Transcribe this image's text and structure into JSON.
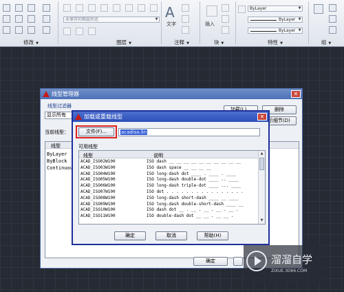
{
  "ribbon": {
    "groups": [
      {
        "name": "修改"
      },
      {
        "name": "图层"
      },
      {
        "name": "注释"
      },
      {
        "name": "块"
      },
      {
        "name": "特性"
      },
      {
        "name": "组"
      }
    ],
    "layer_state": "未保存的图层状态",
    "text_label": "文字",
    "insert_label": "插入",
    "bylayer_1": "ByLayer",
    "bylayer_2": "ByLayer",
    "bylayer_3": "ByLayer"
  },
  "linetype_manager": {
    "title": "线型管理器",
    "filter_group_label": "线型过滤器",
    "filter_value": "显示所有",
    "current_label": "当前线型：",
    "load_button": "加载(L)...",
    "delete_button": "删除",
    "details_button": "示细节(D)",
    "list_header": "线型",
    "items": [
      "ByLayer",
      "ByBlock",
      "Continuous"
    ],
    "ok_button": "确定"
  },
  "load_dialog": {
    "title": "加载或重载线型",
    "file_button": "文件(F)...",
    "file_name": "acadiso.lin",
    "available_label": "可用线型",
    "col_linetype": "线型",
    "col_desc": "说明",
    "rows": [
      {
        "name": "ACAD_ISO02W100",
        "desc": "ISO dash __ __ __ __ __ __ __ __ __ __"
      },
      {
        "name": "ACAD_ISO03W100",
        "desc": "ISO dash space __    __    __    __"
      },
      {
        "name": "ACAD_ISO04W100",
        "desc": "ISO long-dash dot ____ . ____ . ____"
      },
      {
        "name": "ACAD_ISO05W100",
        "desc": "ISO long-dash double-dot ____ .. ____"
      },
      {
        "name": "ACAD_ISO06W100",
        "desc": "ISO long-dash triple-dot ____ ... ____"
      },
      {
        "name": "ACAD_ISO07W100",
        "desc": "ISO dot . . . . . . . . . . . . . . . ."
      },
      {
        "name": "ACAD_ISO08W100",
        "desc": "ISO long-dash short-dash ____ __ ____"
      },
      {
        "name": "ACAD_ISO09W100",
        "desc": "ISO long-dash double-short-dash ____ __"
      },
      {
        "name": "ACAD_ISO10W100",
        "desc": "ISO dash dot __ . __ . __ . __ . __ ."
      },
      {
        "name": "ACAD_ISO11W100",
        "desc": "ISO double-dash dot __ __ . __ __ ."
      }
    ],
    "ok_button": "确定",
    "cancel_button": "取消",
    "help_button": "帮助(H)"
  },
  "watermark": {
    "brand": "溜溜自学",
    "url": "ZIXUE.3D66.COM"
  }
}
